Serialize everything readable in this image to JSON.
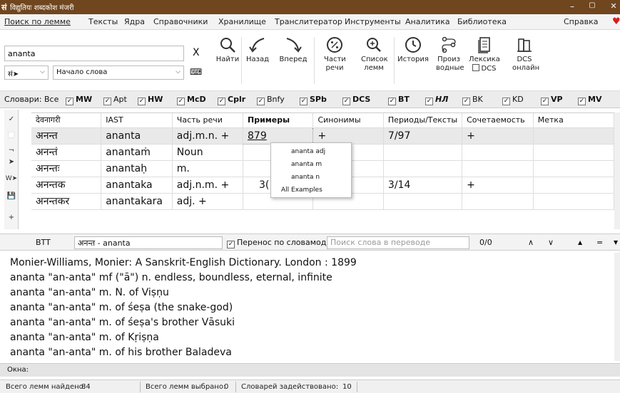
{
  "window": {
    "title": "विद्युतियः शब्दकोश मंजरी",
    "app_icon": "सं",
    "minimize": "–",
    "maximize": "▢",
    "close": "✕"
  },
  "menu": {
    "items": [
      "Поиск по лемме",
      "Тексты",
      "Ядра",
      "Справочники",
      "Хранилище",
      "Транслитератор",
      "Инструменты",
      "Аналитика",
      "Библиотека"
    ],
    "help": "Справка"
  },
  "toolbar": {
    "search_value": "ananta",
    "clear": "X",
    "script_select": "सं➤",
    "mode_select": "Начало слова",
    "find": "Найти",
    "back": "Назад",
    "forward": "Вперед",
    "pos": "Части речи",
    "list": "Список лемм",
    "history": "История",
    "deriv": "Произ водные",
    "lexicon": "Лексика",
    "lexicon_chk": "DCS",
    "dcs": "DCS онлайн"
  },
  "dicts": {
    "label": "Словари:",
    "all": "Все",
    "items": [
      "MW",
      "Apt",
      "HW",
      "McD",
      "Cplr",
      "Bnfy",
      "SPb",
      "DCS",
      "BT",
      "НЛ",
      "BK",
      "KD",
      "VP",
      "MV"
    ]
  },
  "grid": {
    "columns": [
      "देवनागरी",
      "IAST",
      "Часть речи",
      "Примеры",
      "Синонимы",
      "Периоды/Тексты",
      "Сочетаемость",
      "Метка"
    ],
    "rows": [
      [
        "अनन्त",
        "ananta",
        "adj.m.n. +",
        "879",
        "+",
        "7/97",
        "+",
        ""
      ],
      [
        "अनन्तं",
        "anantaṁ",
        "Noun",
        "",
        "",
        "",
        "",
        ""
      ],
      [
        "अनन्तः",
        "anantaḥ",
        "m.",
        "",
        "",
        "",
        "",
        ""
      ],
      [
        "अनन्तक",
        "anantaka",
        "adj.n.m. +",
        "3(",
        "",
        "3/14",
        "+",
        ""
      ],
      [
        "अनन्तकर",
        "anantakara",
        "adj. +",
        "",
        "",
        "",
        "",
        ""
      ]
    ]
  },
  "context_menu": {
    "items": [
      "ananta adj",
      "ananta m",
      "ananta n",
      "All Examples"
    ]
  },
  "left_strip": {
    "items": [
      "✓",
      "■",
      "¬",
      "➤",
      "W➤",
      "💾",
      "+"
    ]
  },
  "transbar": {
    "dict": "BTT",
    "word": "अनन्त - ananta",
    "wrap_label": "Перенос по словамоде",
    "search_placeholder": "Поиск слова в переводе",
    "count": "0/0",
    "up": "∧",
    "down": "∨",
    "first": "▲",
    "eq": "=",
    "last": "▼"
  },
  "article": {
    "lines": [
      "Monier-Williams, Monier: A Sanskrit-English Dictionary. London : 1899",
      "ananta \"an-anta\" mf (\"ā\") n. endless, boundless, eternal, infinite",
      "ananta \"an-anta\" m. N. of Viṣṇu",
      "ananta \"an-anta\" m. of śeṣa (the snake-god)",
      "ananta \"an-anta\" m. of śeṣa's brother Vāsuki",
      "ananta \"an-anta\" m. of Kṛiṣṇa",
      "ananta \"an-anta\" m. of his brother Baladeva"
    ]
  },
  "okna": {
    "label": "Окна:"
  },
  "status": {
    "found_label": "Всего лемм найдено:",
    "found": "84",
    "selected_label": "Всего лемм выбрано:",
    "selected": "0",
    "dicts_label": "Словарей задействовано:",
    "dicts": "10"
  }
}
